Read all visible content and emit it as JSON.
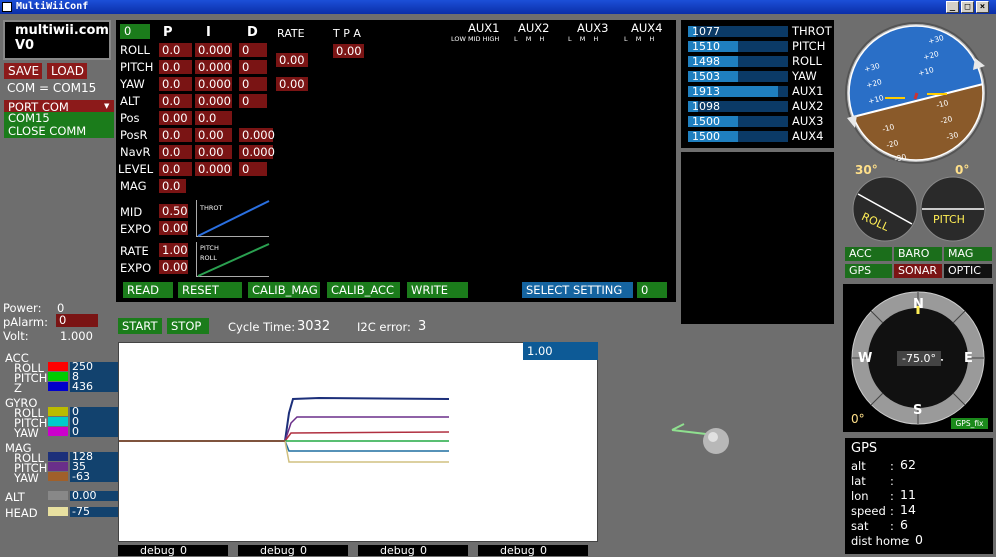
{
  "window": {
    "title": "MultiWiiConf"
  },
  "brand": {
    "title": "multiwii.com",
    "version": "V0"
  },
  "left": {
    "save": "SAVE",
    "load": "LOAD",
    "com": "COM = COM15",
    "port_com": "PORT COM",
    "port_item": "COM15",
    "close_comm": "CLOSE COMM",
    "power_label": "Power:",
    "power_value": "0",
    "palarm_label": "pAlarm:",
    "palarm_value": "0",
    "volt_label": "Volt:",
    "volt_value": "1.000"
  },
  "pid": {
    "profile": "0",
    "headers": {
      "p": "P",
      "i": "I",
      "d": "D",
      "rate": "RATE",
      "tpa": "T P A"
    },
    "rows": [
      {
        "name": "ROLL",
        "p": "0.0",
        "i": "0.000",
        "d": "0"
      },
      {
        "name": "PITCH",
        "p": "0.0",
        "i": "0.000",
        "d": "0"
      },
      {
        "name": "YAW",
        "p": "0.0",
        "i": "0.000",
        "d": "0"
      },
      {
        "name": "ALT",
        "p": "0.0",
        "i": "0.000",
        "d": "0"
      },
      {
        "name": "Pos",
        "p": "0.00",
        "i": "0.0",
        "d": ""
      },
      {
        "name": "PosR",
        "p": "0.0",
        "i": "0.00",
        "d": "0.000"
      },
      {
        "name": "NavR",
        "p": "0.0",
        "i": "0.00",
        "d": "0.000"
      },
      {
        "name": "LEVEL",
        "p": "0.0",
        "i": "0.000",
        "d": "0"
      },
      {
        "name": "MAG",
        "p": "0.0",
        "i": "",
        "d": ""
      }
    ],
    "rate1": "0.00",
    "rate2": "0.00",
    "tpa": "0.00",
    "mid_label": "MID",
    "mid": "0.50",
    "expo_label": "EXPO",
    "expo": "0.00",
    "rate_label": "RATE",
    "rate": "1.00",
    "expo2_label": "EXPO",
    "expo2": "0.00",
    "throt_chart": "THROT",
    "pitchroll_chart_1": "PITCH",
    "pitchroll_chart_2": "ROLL"
  },
  "aux": {
    "headers": [
      "AUX1",
      "AUX2",
      "AUX3",
      "AUX4"
    ],
    "sub1": "LOW MID HIGH",
    "sub": "L   M   H"
  },
  "actions": {
    "read": "READ",
    "reset": "RESET",
    "calib_mag": "CALIB_MAG",
    "calib_acc": "CALIB_ACC",
    "write": "WRITE",
    "select_setting": "SELECT SETTING",
    "setting_value": "0"
  },
  "rc": [
    {
      "name": "THROT",
      "value": "1077",
      "level": 0.08
    },
    {
      "name": "PITCH",
      "value": "1510",
      "level": 0.5
    },
    {
      "name": "ROLL",
      "value": "1498",
      "level": 0.5
    },
    {
      "name": "YAW",
      "value": "1503",
      "level": 0.5
    },
    {
      "name": "AUX1",
      "value": "1913",
      "level": 0.9
    },
    {
      "name": "AUX2",
      "value": "1098",
      "level": 0.1
    },
    {
      "name": "AUX3",
      "value": "1500",
      "level": 0.5
    },
    {
      "name": "AUX4",
      "value": "1500",
      "level": 0.5
    }
  ],
  "graph": {
    "start": "START",
    "stop": "STOP",
    "cycle_label": "Cycle Time:",
    "cycle_value": "3032",
    "i2c_label": "I2C error:",
    "i2c_value": "3",
    "scale": "1.00",
    "debug": [
      "debug",
      "debug",
      "debug",
      "debug"
    ],
    "debug_values": [
      "0",
      "0",
      "0",
      "0"
    ],
    "colors": {
      "acc_roll": "#ff0000",
      "acc_pitch": "#00cc00",
      "acc_z": "#0000cc",
      "gyro_roll": "#bbbb00",
      "gyro_pitch": "#00cccc",
      "gyro_yaw": "#cc00cc",
      "mag_roll": "#1c2f7a",
      "mag_pitch": "#6a2f8a",
      "mag_yaw": "#a0602a"
    }
  },
  "sensors": {
    "acc": "ACC",
    "acc_rows": [
      {
        "name": "ROLL",
        "value": "250"
      },
      {
        "name": "PITCH",
        "value": "8"
      },
      {
        "name": "Z",
        "value": "436"
      }
    ],
    "gyro": "GYRO",
    "gyro_rows": [
      {
        "name": "ROLL",
        "value": "0"
      },
      {
        "name": "PITCH",
        "value": "0"
      },
      {
        "name": "YAW",
        "value": "0"
      }
    ],
    "mag": "MAG",
    "mag_rows": [
      {
        "name": "ROLL",
        "value": "128"
      },
      {
        "name": "PITCH",
        "value": "35"
      },
      {
        "name": "YAW",
        "value": "-63"
      }
    ],
    "alt": "ALT",
    "alt_value": "0.00",
    "head": "HEAD",
    "head_value": "-75"
  },
  "horizon": {
    "ticks": [
      "+30",
      "+20",
      "+10",
      "-10",
      "-20",
      "-30",
      "+30",
      "+20",
      "+10",
      "-10",
      "-20",
      "-30"
    ],
    "roll_angle": "30°",
    "pitch_angle": "0°",
    "roll_label": "ROLL",
    "pitch_label": "PITCH"
  },
  "sensor_flags": {
    "acc": "ACC",
    "baro": "BARO",
    "mag": "MAG",
    "gps": "GPS",
    "sonar": "SONAR",
    "optic": "OPTIC"
  },
  "compass": {
    "n": "N",
    "s": "S",
    "e": "E",
    "w": "W",
    "heading": "-75.0°",
    "zero": "0°",
    "gps_fix": "GPS_fix"
  },
  "gps": {
    "title": "GPS",
    "rows": [
      {
        "label": "alt",
        "value": "62"
      },
      {
        "label": "lat",
        "value": ""
      },
      {
        "label": "lon",
        "value": "11"
      },
      {
        "label": "speed",
        "value": "14"
      },
      {
        "label": "sat",
        "value": "6"
      },
      {
        "label": "dist home",
        "value": "0"
      }
    ]
  }
}
